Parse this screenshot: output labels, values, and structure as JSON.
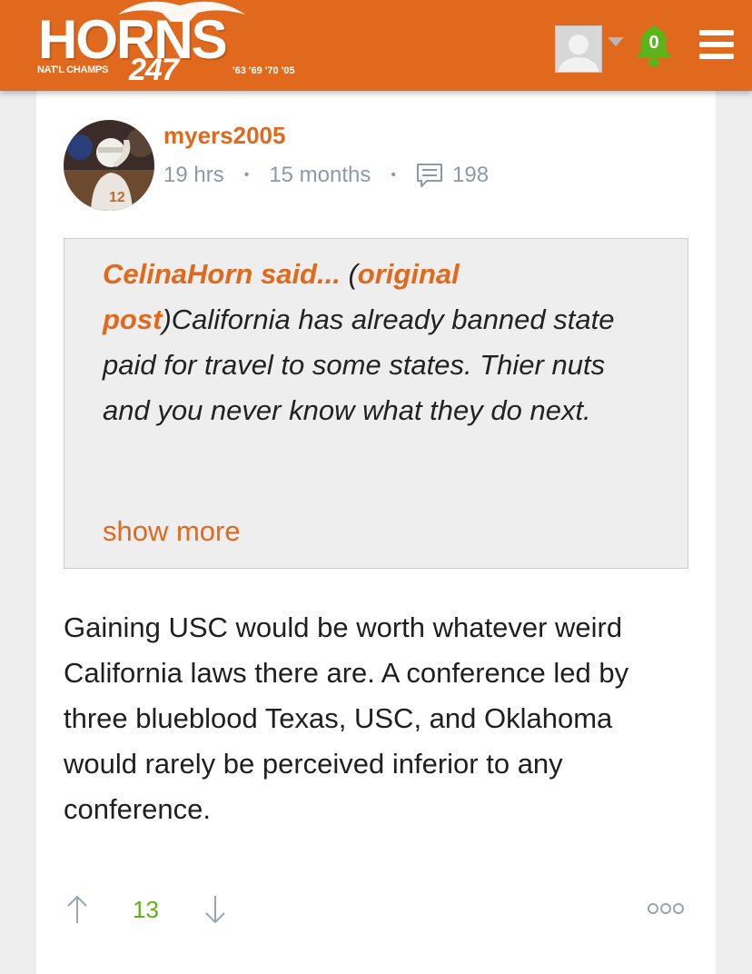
{
  "header": {
    "logo_main": "HORNS",
    "logo_natl": "NAT'L CHAMPS",
    "logo_247": "247",
    "logo_years": "'63 '69 '70 '05",
    "notification_count": "0",
    "brand_color": "#e0691d",
    "notification_color": "#5db31a"
  },
  "post": {
    "username": "myers2005",
    "time": "19 hrs",
    "membership": "15 months",
    "comment_count": "198",
    "quote": {
      "author_said": "CelinaHorn said...",
      "paren_open": " (",
      "link_text": "original post",
      "paren_close": ")",
      "text": "California has already banned state paid for travel to some states. Thier nuts and you never know what they do next.",
      "show_more": "show more"
    },
    "body": "Gaining USC would be worth whatever weird California laws there are. A conference led by three blueblood Texas, USC, and Oklahoma would rarely be perceived inferior to any conference.",
    "votes": "13"
  }
}
